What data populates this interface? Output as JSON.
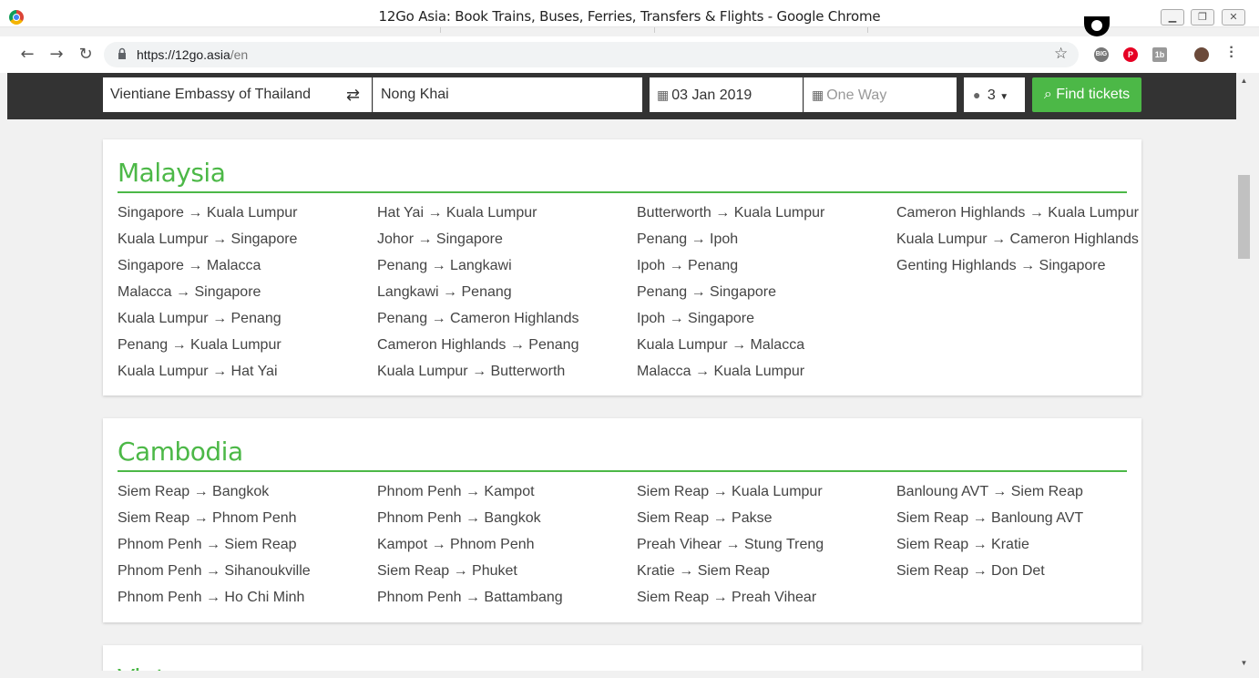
{
  "window": {
    "title": "12Go Asia: Book Trains, Buses, Ferries, Transfers & Flights - Google Chrome"
  },
  "browser": {
    "url_host": "https://12go.asia",
    "url_path": "/en",
    "ext_labels": [
      "BIG",
      "P",
      "1b"
    ]
  },
  "search": {
    "from": "Vientiane Embassy of Thailand",
    "to": "Nong Khai",
    "date": "03 Jan 2019",
    "return_placeholder": "One Way",
    "passengers": "3",
    "find_label": "Find tickets"
  },
  "sections": [
    {
      "title": "Malaysia",
      "columns": [
        [
          "Singapore → Kuala Lumpur",
          "Kuala Lumpur → Singapore",
          "Singapore → Malacca",
          "Malacca → Singapore",
          "Kuala Lumpur → Penang",
          "Penang → Kuala Lumpur",
          "Kuala Lumpur → Hat Yai"
        ],
        [
          "Hat Yai → Kuala Lumpur",
          "Johor → Singapore",
          "Penang → Langkawi",
          "Langkawi → Penang",
          "Penang → Cameron Highlands",
          "Cameron Highlands → Penang",
          "Kuala Lumpur → Butterworth"
        ],
        [
          "Butterworth → Kuala Lumpur",
          "Penang → Ipoh",
          "Ipoh → Penang",
          "Penang → Singapore",
          "Ipoh → Singapore",
          "Kuala Lumpur → Malacca",
          "Malacca → Kuala Lumpur"
        ],
        [
          "Cameron Highlands → Kuala Lumpur",
          "Kuala Lumpur → Cameron Highlands",
          "Genting Highlands → Singapore"
        ]
      ]
    },
    {
      "title": "Cambodia",
      "columns": [
        [
          "Siem Reap → Bangkok",
          "Siem Reap → Phnom Penh",
          "Phnom Penh → Siem Reap",
          "Phnom Penh → Sihanoukville",
          "Phnom Penh → Ho Chi Minh"
        ],
        [
          "Phnom Penh → Kampot",
          "Phnom Penh → Bangkok",
          "Kampot → Phnom Penh",
          "Siem Reap → Phuket",
          "Phnom Penh → Battambang"
        ],
        [
          "Siem Reap → Kuala Lumpur",
          "Siem Reap → Pakse",
          "Preah Vihear → Stung Treng",
          "Kratie → Siem Reap",
          "Siem Reap → Preah Vihear"
        ],
        [
          "Banloung AVT → Siem Reap",
          "Siem Reap → Banloung AVT",
          "Siem Reap → Kratie",
          "Siem Reap → Don Det"
        ]
      ]
    },
    {
      "title": "Vietnam",
      "columns": []
    }
  ],
  "colors": {
    "brand_green": "#4cb847",
    "searchbar_bg": "#333333"
  }
}
